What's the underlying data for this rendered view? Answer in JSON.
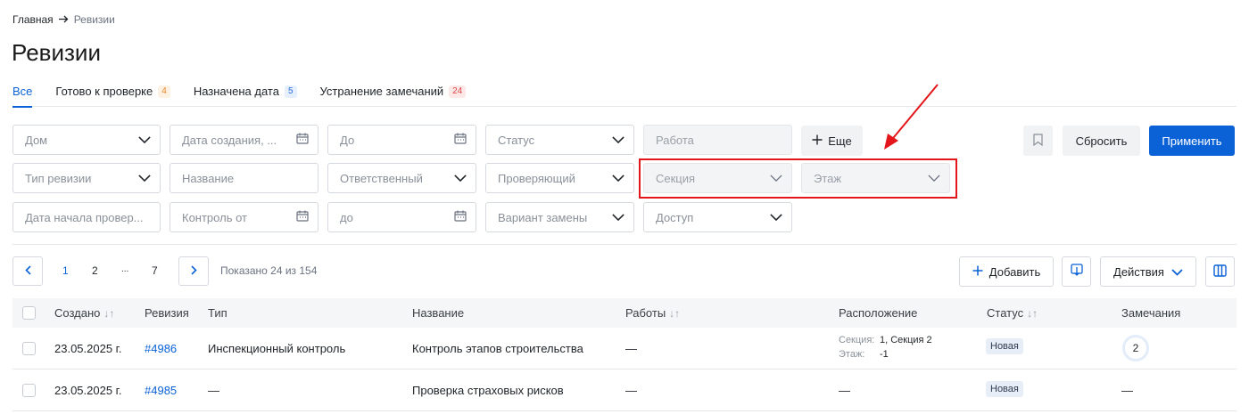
{
  "breadcrumb": {
    "home": "Главная",
    "current": "Ревизии"
  },
  "title": "Ревизии",
  "tabs": [
    {
      "label": "Все",
      "badge": ""
    },
    {
      "label": "Готово к проверке",
      "badge": "4"
    },
    {
      "label": "Назначена дата",
      "badge": "5"
    },
    {
      "label": "Устранение замечаний",
      "badge": "24"
    }
  ],
  "filters": {
    "house": "Дом",
    "created_date": "Дата создания, ...",
    "to": "До",
    "status": "Статус",
    "work": "Работа",
    "more": "Еще",
    "revision_type": "Тип ревизии",
    "name": "Название",
    "responsible": "Ответственный",
    "inspector": "Проверяющий",
    "section": "Секция",
    "floor": "Этаж",
    "check_start": "Дата начала провер...",
    "control_from": "Контроль от",
    "to_lower": "до",
    "replacement": "Вариант замены",
    "access": "Доступ"
  },
  "actions": {
    "reset": "Сбросить",
    "apply": "Применить",
    "add": "Добавить",
    "actions": "Действия"
  },
  "pagination": {
    "pages": [
      "1",
      "2",
      "...",
      "7"
    ],
    "shown": "Показано 24 из 154"
  },
  "table": {
    "headers": [
      "Создано",
      "Ревизия",
      "Тип",
      "Название",
      "Работы",
      "Расположение",
      "Статус",
      "Замечания"
    ],
    "rows": [
      {
        "created": "23.05.2025 г.",
        "revision": "#4986",
        "type": "Инспекционный контроль",
        "name": "Контроль этапов строительства",
        "works": "—",
        "loc_section_label": "Секция:",
        "loc_section": "1, Секция 2",
        "loc_floor_label": "Этаж:",
        "loc_floor": "-1",
        "status": "Новая",
        "remarks": "2"
      },
      {
        "created": "23.05.2025 г.",
        "revision": "#4985",
        "type": "—",
        "name": "Проверка страховых рисков",
        "works": "—",
        "location": "—",
        "status": "Новая",
        "remarks": "—"
      }
    ]
  },
  "colors": {
    "primary": "#0b62d6",
    "highlight": "#e3161b"
  }
}
